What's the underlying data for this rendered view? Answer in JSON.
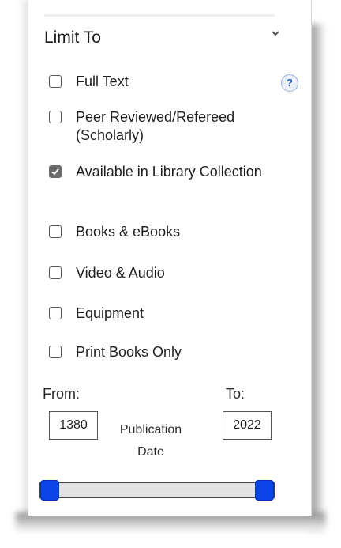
{
  "filter": {
    "title": "Limit To",
    "help_glyph": "?",
    "options": [
      {
        "label": "Full Text",
        "checked": false
      },
      {
        "label": "Peer Reviewed/Refereed (Scholarly)",
        "checked": false
      },
      {
        "label": "Available in Library Collection",
        "checked": true
      },
      {
        "label": "Books & eBooks",
        "checked": false
      },
      {
        "label": "Video & Audio",
        "checked": false
      },
      {
        "label": "Equipment",
        "checked": false
      },
      {
        "label": "Print Books Only",
        "checked": false
      }
    ]
  },
  "date_range": {
    "from_label": "From:",
    "to_label": "To:",
    "from_value": "1380",
    "to_value": "2022",
    "caption_line1": "Publication",
    "caption_line2": "Date",
    "slider_low_fraction": 0.0,
    "slider_high_fraction": 1.0
  },
  "colors": {
    "slider_handle": "#0a43e6",
    "checked_box": "#6b6b6b",
    "help_icon": "#2a5db0"
  }
}
